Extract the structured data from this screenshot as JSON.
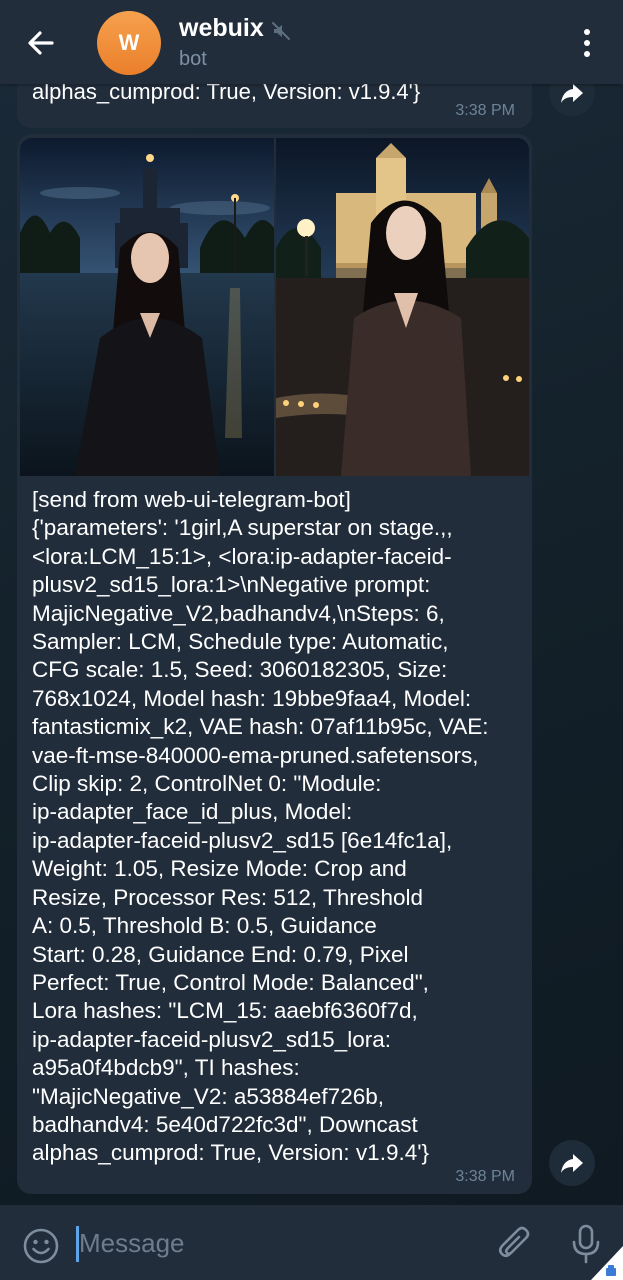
{
  "header": {
    "title": "webuix",
    "subtitle": "bot",
    "avatar_letter": "W"
  },
  "messages": [
    {
      "text_visible": "alphas_cumprod: True, Version: v1.9.4'}",
      "time": "3:38 PM"
    },
    {
      "text": "[send from web-ui-telegram-bot]\n{'parameters': '1girl,A superstar on stage.,,\n<lora:LCM_15:1>, <lora:ip-adapter-faceid-\nplusv2_sd15_lora:1>\\nNegative prompt:\nMajicNegative_V2,badhandv4,\\nSteps: 6,\nSampler: LCM, Schedule type: Automatic,\nCFG scale: 1.5, Seed: 3060182305, Size:\n768x1024, Model hash: 19bbe9faa4, Model:\nfantasticmix_k2, VAE hash: 07af11b95c, VAE:\nvae-ft-mse-840000-ema-pruned.safetensors,\nClip skip: 2, ControlNet 0: \"Module:\nip-adapter_face_id_plus, Model:\nip-adapter-faceid-plusv2_sd15 [6e14fc1a],\nWeight: 1.05, Resize Mode: Crop and\nResize, Processor Res: 512, Threshold\nA: 0.5, Threshold B: 0.5, Guidance\nStart: 0.28, Guidance End: 0.79, Pixel\nPerfect: True, Control Mode: Balanced\",\nLora hashes: \"LCM_15: aaebf6360f7d,\nip-adapter-faceid-plusv2_sd15_lora:\na95a0f4bdcb9\", TI hashes:\n\"MajicNegative_V2: a53884ef726b,\nbadhandv4: 5e40d722fc3d\", Downcast\nalphas_cumprod: True, Version: v1.9.4'}",
      "time": "3:38 PM"
    }
  ],
  "input": {
    "placeholder": "Message"
  },
  "icons": {
    "back": "arrow-left-icon",
    "mute": "muted-speaker-icon",
    "menu": "more-vertical-icon",
    "forward": "forward-arrow-icon",
    "emoji": "emoji-smile-icon",
    "attach": "paperclip-icon",
    "mic": "microphone-icon"
  },
  "colors": {
    "header_bg": "#212d3b",
    "bubble_bg": "#212d3b",
    "avatar": "#ee8a33",
    "time": "#6e8397",
    "accent": "#5ea5e8"
  }
}
